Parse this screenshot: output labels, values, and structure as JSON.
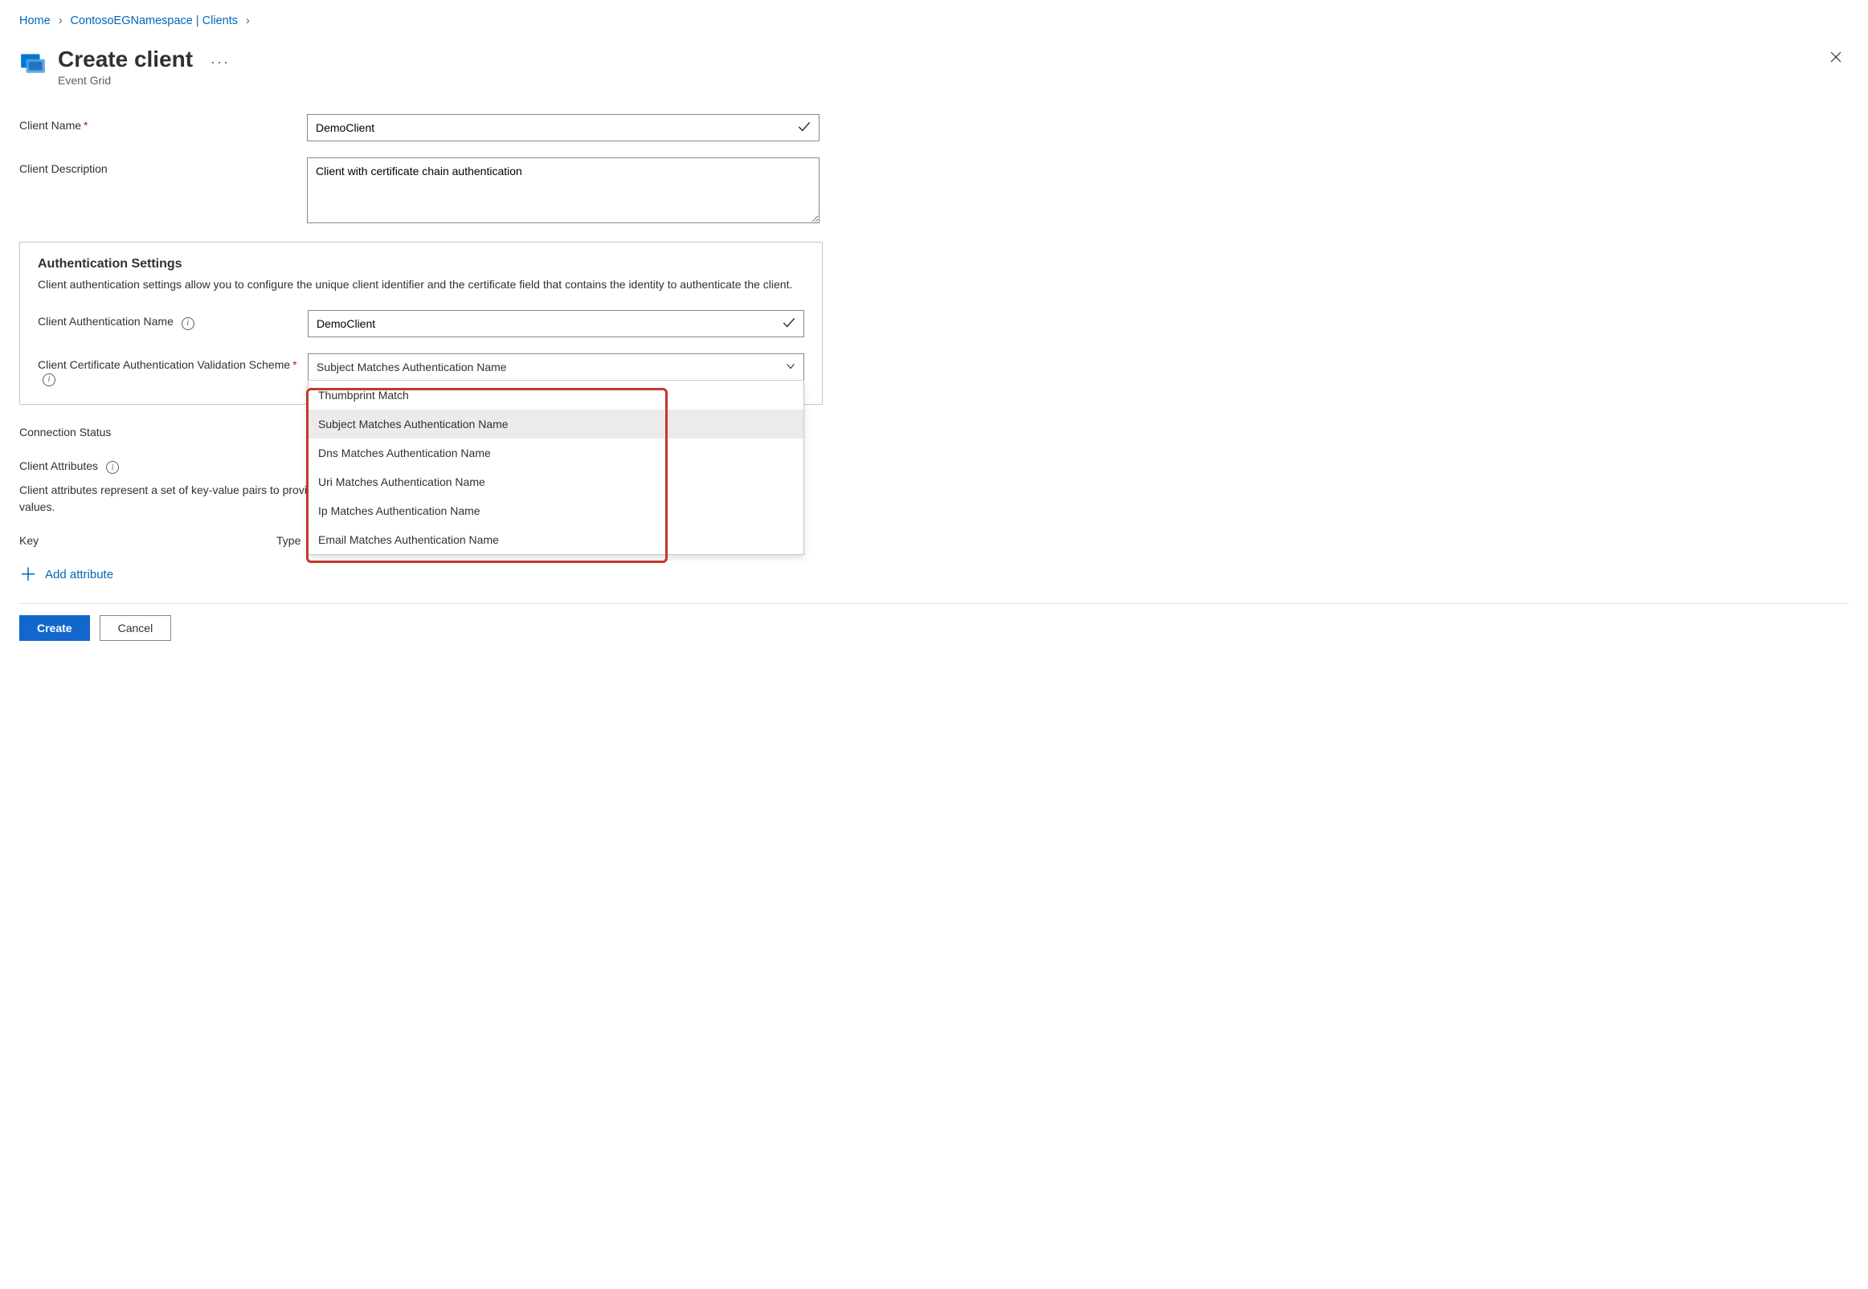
{
  "breadcrumb": {
    "home": "Home",
    "namespace": "ContosoEGNamespace | Clients"
  },
  "header": {
    "title": "Create client",
    "subtitle": "Event Grid"
  },
  "form": {
    "clientName": {
      "label": "Client Name",
      "value": "DemoClient"
    },
    "clientDescription": {
      "label": "Client Description",
      "value": "Client with certificate chain authentication"
    }
  },
  "auth": {
    "heading": "Authentication Settings",
    "description": "Client authentication settings allow you to configure the unique client identifier and the certificate field that contains the identity to authenticate the client.",
    "authName": {
      "label": "Client Authentication Name",
      "value": "DemoClient"
    },
    "validationScheme": {
      "label": "Client Certificate Authentication Validation Scheme",
      "selected": "Subject Matches Authentication Name",
      "options": [
        "Thumbprint Match",
        "Subject Matches Authentication Name",
        "Dns Matches Authentication Name",
        "Uri Matches Authentication Name",
        "Ip Matches Authentication Name",
        "Email Matches Authentication Name"
      ]
    }
  },
  "connectionStatus": {
    "label": "Connection Status"
  },
  "attributes": {
    "heading": "Client Attributes",
    "description": "Client attributes represent a set of key-value pairs to provide descriptive information about the client.  You can create client groups based on common attribute values.",
    "keyHeader": "Key",
    "typeHeader": "Type",
    "addButton": "Add attribute"
  },
  "footer": {
    "create": "Create",
    "cancel": "Cancel"
  }
}
